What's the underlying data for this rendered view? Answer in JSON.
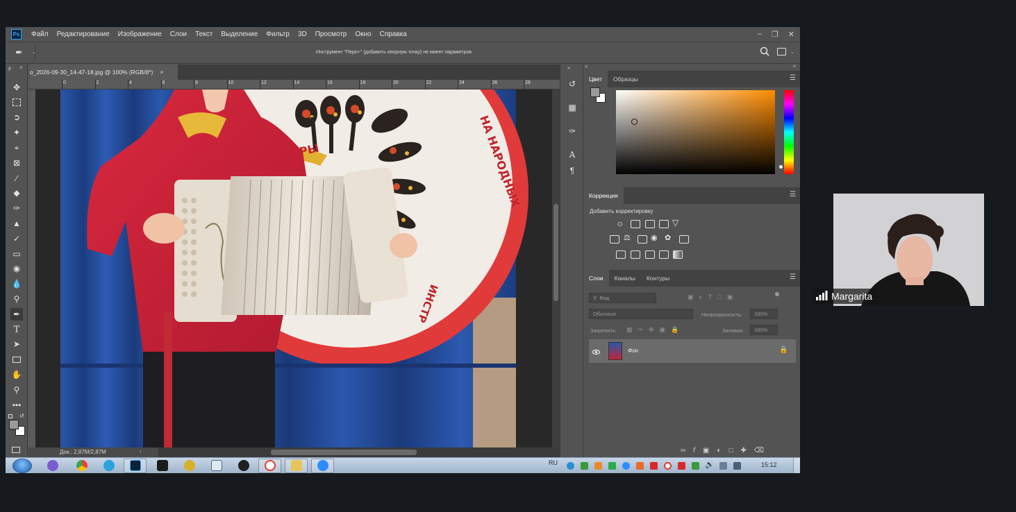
{
  "app": {
    "logo": "Ps",
    "menu": [
      "Файл",
      "Редактирование",
      "Изображение",
      "Слои",
      "Текст",
      "Выделение",
      "Фильтр",
      "3D",
      "Просмотр",
      "Окно",
      "Справка"
    ],
    "window_controls": [
      "minimize-icon",
      "restore-icon",
      "close-icon"
    ]
  },
  "options_bar": {
    "tool_icon": "pen-icon",
    "hint": "Инструмент \"Перо+\" (добавить опорную точку) не имеет параметров."
  },
  "document": {
    "tab_title": "o_2026-09-30_14-47-18.jpg @ 100% (RGB/8*)",
    "ruler_ticks": [
      "0",
      "2",
      "4",
      "6",
      "8",
      "10",
      "12",
      "14",
      "16",
      "18",
      "20",
      "22",
      "24",
      "26",
      "28"
    ],
    "status": "Док.: 2,87M/2,87M",
    "image_text": {
      "ribbon_word": "УЗОРЫ",
      "ring_right": "НА НАРОДНЫХ",
      "ring_bottom": "ИНСТР"
    }
  },
  "tools": [
    "move-icon",
    "marquee-icon",
    "lasso-icon",
    "quick-select-icon",
    "crop-icon",
    "frame-icon",
    "eyedropper-icon",
    "healing-icon",
    "brush-icon",
    "stamp-icon",
    "history-brush-icon",
    "eraser-icon",
    "bucket-icon",
    "blur-icon",
    "dodge-icon",
    "pen-icon",
    "type-icon",
    "path-select-icon",
    "rectangle-icon",
    "hand-icon",
    "zoom-icon",
    "more-icon"
  ],
  "colors": {
    "foreground": "#9a9a9a",
    "background": "#ffffff",
    "picker_hue": "#ff8c00"
  },
  "color_panel": {
    "tabs": [
      "Цвет",
      "Образцы"
    ]
  },
  "adjustments_panel": {
    "tab": "Коррекция",
    "subtitle": "Добавить корректировку"
  },
  "layers_panel": {
    "tabs": [
      "Слои",
      "Каналы",
      "Контуры"
    ],
    "filter_placeholder": "Вид",
    "blend_mode": "Обычные",
    "opacity_label": "Непрозрачность:",
    "opacity_value": "100%",
    "lock_label": "Закрепить:",
    "fill_label": "Заливка:",
    "fill_value": "100%",
    "layers": [
      {
        "name": "Фон",
        "visible": true,
        "locked": true
      }
    ]
  },
  "taskbar": {
    "lang": "RU",
    "time": "15:12"
  },
  "video": {
    "participant": "Margarita"
  }
}
